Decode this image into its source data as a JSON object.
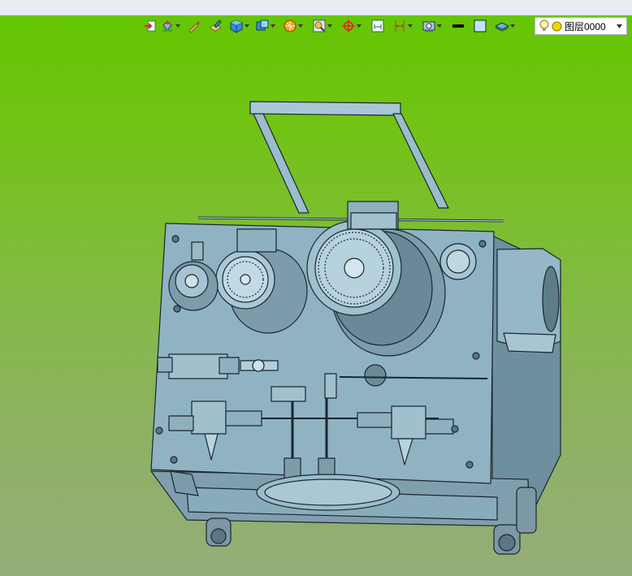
{
  "toolbar": {
    "buttons": [
      {
        "name": "import-icon",
        "dropdown": false
      },
      {
        "name": "paint-bucket-icon",
        "dropdown": true
      },
      {
        "name": "brush-icon",
        "dropdown": false
      },
      {
        "name": "pencil-box-icon",
        "dropdown": false
      },
      {
        "name": "shaded-cube-icon",
        "dropdown": true
      },
      {
        "name": "view-orient-icon",
        "dropdown": true
      },
      {
        "name": "section-view-icon",
        "dropdown": true
      },
      {
        "name": "zoom-fit-icon",
        "dropdown": true
      },
      {
        "name": "pan-crosshair-icon",
        "dropdown": true
      },
      {
        "name": "measure-icon",
        "dropdown": false
      },
      {
        "name": "dimension-icon",
        "dropdown": true
      },
      {
        "name": "render-settings-icon",
        "dropdown": true
      },
      {
        "name": "line-weight-icon",
        "dropdown": false
      },
      {
        "name": "fill-color-icon",
        "dropdown": false
      },
      {
        "name": "layer-visibility-icon",
        "dropdown": true
      }
    ]
  },
  "layer": {
    "current": "图层0000",
    "visible_color": "#f5d400"
  },
  "colors": {
    "background_top": "#63c600",
    "background_bottom": "#95ad78",
    "model_fill": "#8fb3c3",
    "model_outline": "#1a2630"
  }
}
